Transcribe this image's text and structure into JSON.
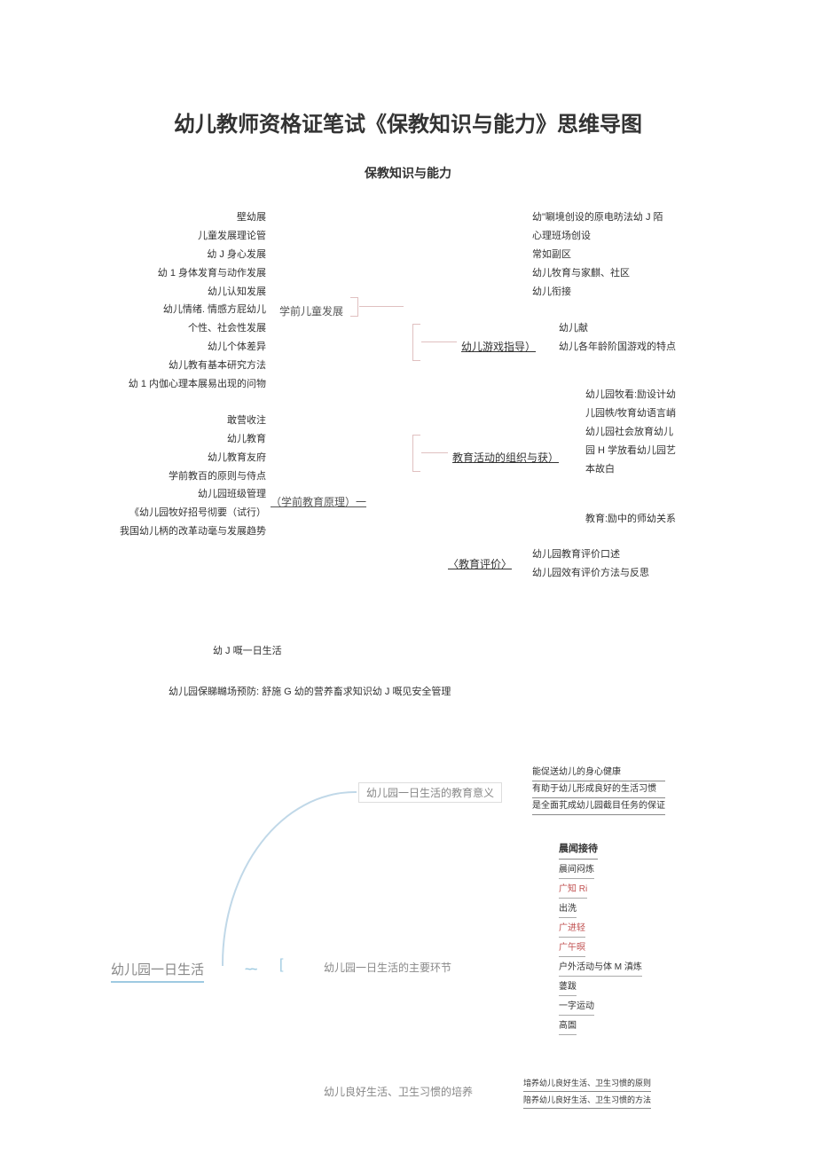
{
  "title": "幼儿教师资格证笔试《保教知识与能力》思维导图",
  "subtitle": "保教知识与能力",
  "map1": {
    "left_group1": [
      "壁幼展",
      "儿童发展理论管",
      "幼 J 身心发展",
      "幼 1 身体发育与动作发展",
      "幼儿认知发展",
      "幼儿情绪. 情感方屁幼儿",
      "个性、社会性发展",
      "幼儿个体差异",
      "幼儿教有基本研究方法",
      "幼 1 内伽心理本展易出现的问物"
    ],
    "left_group2": [
      "敢营收注",
      "幼儿教育",
      "幼儿教育友府",
      "学前教百的原则与侍点",
      "幼儿园班级管理",
      "《幼儿园牧好招号彻要（试行）",
      "我国幼儿柄的改革动毫与发展趋势"
    ],
    "center1": "学前儿童发展",
    "center2": "（学前教育原理）一",
    "right1": [
      "幼\"唰境创设的原电昉法幼 J 陌",
      "心理班场创设",
      "常如副区",
      "幼儿牧育与家麒、社区",
      "幼儿衔接"
    ],
    "right2_label": "幼儿游戏指导）",
    "right2": [
      "幼儿献",
      "幼儿各年龄阶国游戏的特点"
    ],
    "right3_label": "教育活动的组织与获）",
    "right3": [
      "幼儿园牧看:励设计幼",
      "儿园帙/牧育幼语言峭",
      "幼儿园社会放育幼儿",
      "园 H 学放看幼儿园艺",
      "本故白"
    ],
    "right4": "教育:励中的师幼关系",
    "right5_label": "〈教育评价〉",
    "right5": [
      "幼儿园教育评价口述",
      "幼儿园效有评价方法与反思"
    ]
  },
  "lower1": "幼 J 嘅一日生活",
  "lower2": "幼儿园保睇矊场预防: 舒施 G 幼的营养畜求知识幼 J 嘅见安全管理",
  "map2": {
    "root": "幼儿园一日生活",
    "tilde": "~~",
    "bracket": "[",
    "b1_label": "幼儿园一日生活的教育意义",
    "b1": [
      "能促送幼儿的身心健康",
      "有助于幼儿形成良好的生活习惯",
      "是全面芤成幼儿园截目任务的保证"
    ],
    "b2_label": "幼儿园一日生活的主要环节",
    "b2_head": "晨闻接待",
    "b2": [
      "晨间闷炼",
      "广知 Ri",
      "出洗",
      "广进轻",
      "广午暝",
      "户外活动与体 M 滇炼",
      "蔢跋",
      "一字运动",
      "高圄"
    ],
    "b3_label": "幼儿良好生活、卫生习惯的培养",
    "b3": [
      "堷养幼儿良好生活、卫生习惯的原则",
      "陪养幼儿良好生活、卫生习惯的方法"
    ]
  }
}
